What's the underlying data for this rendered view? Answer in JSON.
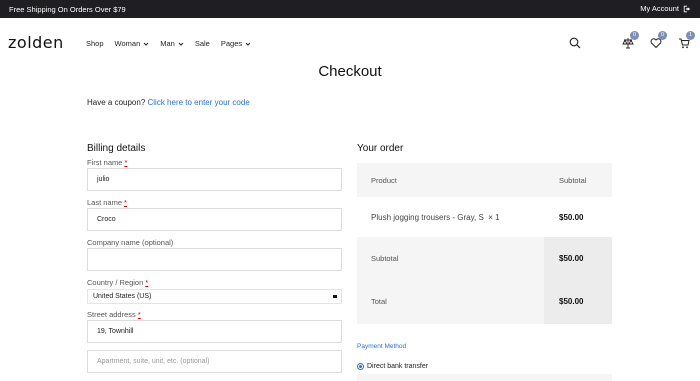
{
  "topbar": {
    "promo": "Free Shipping On Orders Over $79",
    "account": "My Account",
    "account_icon": "logout-icon"
  },
  "header": {
    "logo": "zolden",
    "nav": [
      {
        "label": "Shop",
        "has_dropdown": false
      },
      {
        "label": "Woman",
        "has_dropdown": true
      },
      {
        "label": "Man",
        "has_dropdown": true
      },
      {
        "label": "Sale",
        "has_dropdown": false
      },
      {
        "label": "Pages",
        "has_dropdown": true
      }
    ],
    "icons": {
      "search": "search-icon",
      "compare": {
        "icon": "scale-icon",
        "count": "0"
      },
      "wishlist": {
        "icon": "heart-icon",
        "count": "0"
      },
      "cart": {
        "icon": "cart-icon",
        "count": "1"
      }
    },
    "badge_color": "#7e8fb4"
  },
  "page": {
    "title": "Checkout",
    "coupon_prefix": "Have a coupon?",
    "coupon_link": "Click here to enter your code"
  },
  "billing": {
    "title": "Billing details",
    "required_mark": "*",
    "first_name": {
      "label": "First name",
      "value": "julio"
    },
    "last_name": {
      "label": "Last name",
      "value": "Croco"
    },
    "company": {
      "label": "Company name (optional)",
      "value": ""
    },
    "country": {
      "label": "Country / Region",
      "value": "United States (US)"
    },
    "street": {
      "label": "Street address",
      "value": "19, Townhill",
      "placeholder2": "Apartment, suite, unit, etc. (optional)"
    }
  },
  "order": {
    "title": "Your order",
    "col_product": "Product",
    "col_subtotal": "Subtotal",
    "item_name": "Plush jogging trousers - Gray, S",
    "item_qty": "× 1",
    "item_price": "$50.00",
    "subtotal_label": "Subtotal",
    "subtotal_value": "$50.00",
    "total_label": "Total",
    "total_value": "$50.00"
  },
  "payment": {
    "title": "Payment Method",
    "option": "Direct bank transfer",
    "selected": true
  },
  "colors": {
    "link": "#2f6fd0",
    "topbar_bg": "#1f1f23"
  }
}
